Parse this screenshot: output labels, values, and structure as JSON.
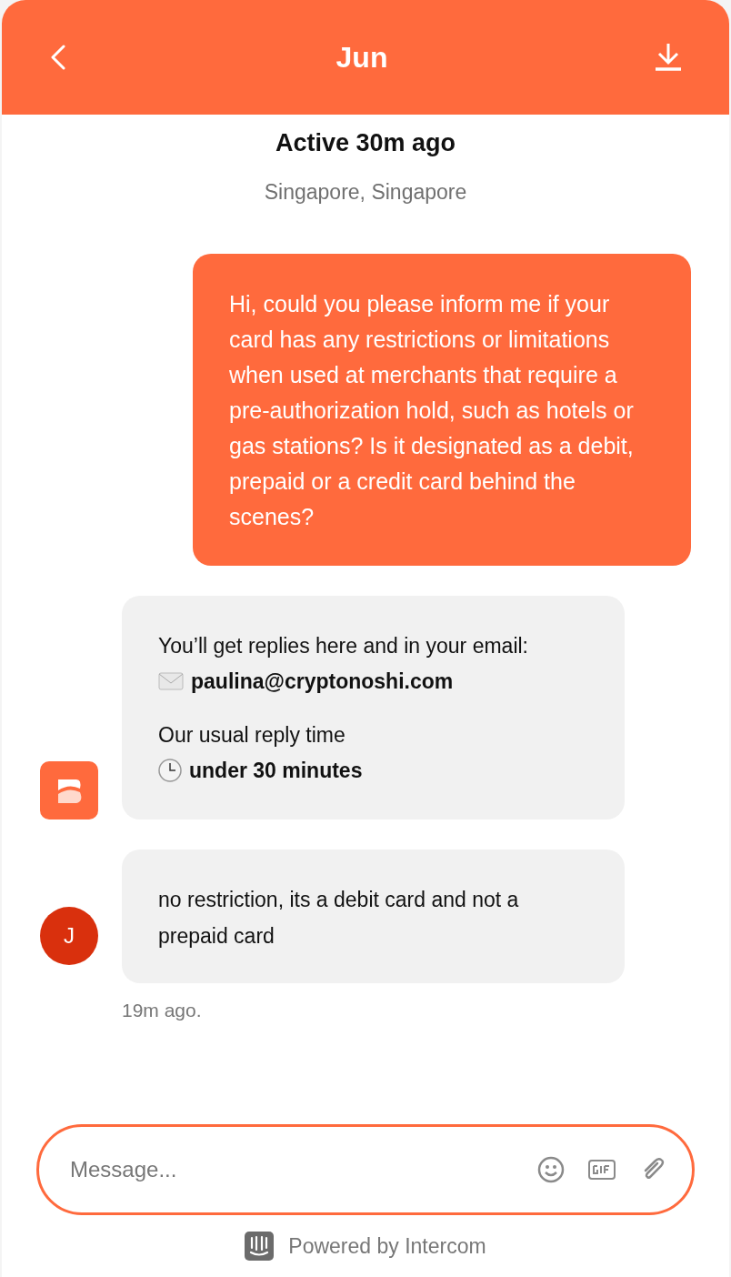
{
  "header": {
    "title": "Jun"
  },
  "status": {
    "active": "Active 30m ago",
    "location": "Singapore, Singapore"
  },
  "messages": [
    {
      "kind": "user",
      "text": "Hi, could you please inform me if your card has any restrictions or limitations when used at merchants that require a pre-authorization hold, such as hotels or gas stations? Is it designated as a debit, prepaid or a credit card behind the scenes?"
    },
    {
      "kind": "notice",
      "intro": "You’ll get replies here and in your email:",
      "email": "paulina@cryptonoshi.com",
      "reply_label": "Our usual reply time",
      "reply_time": "under 30 minutes"
    },
    {
      "kind": "agent",
      "avatar": "J",
      "text": "no restriction, its a debit card and not a prepaid card",
      "time": "19m ago."
    }
  ],
  "composer": {
    "placeholder": "Message..."
  },
  "footer": "Powered by Intercom"
}
